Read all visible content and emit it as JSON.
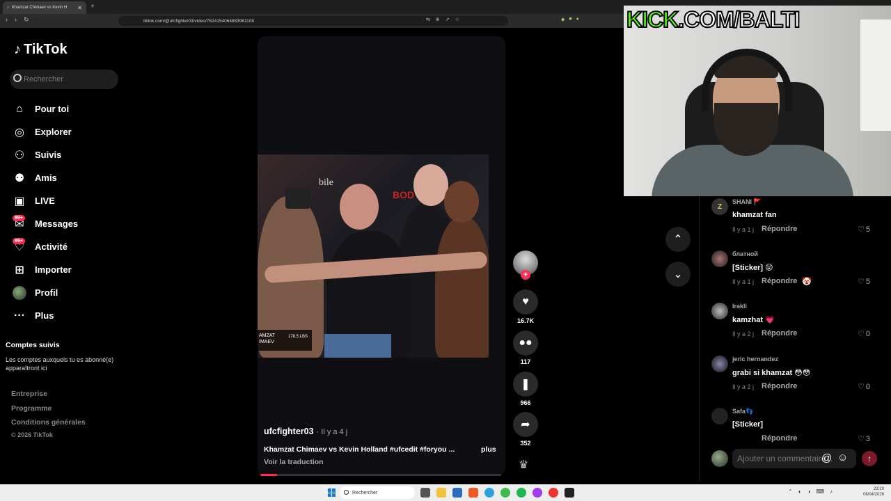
{
  "browser": {
    "tab_title": "Khamzat Chimaev vs Kevin H",
    "url": "tiktok.com/@ufcfighter03/video/7624154064883961108"
  },
  "sidebar": {
    "logo": "TikTok",
    "search_placeholder": "Rechercher",
    "items": [
      {
        "label": "Pour toi",
        "icon": "home-icon"
      },
      {
        "label": "Explorer",
        "icon": "compass-icon"
      },
      {
        "label": "Suivis",
        "icon": "following-icon"
      },
      {
        "label": "Amis",
        "icon": "friends-icon"
      },
      {
        "label": "LIVE",
        "icon": "live-icon"
      },
      {
        "label": "Messages",
        "icon": "messages-icon",
        "badge": "99+"
      },
      {
        "label": "Activité",
        "icon": "activity-icon",
        "badge": "99+"
      },
      {
        "label": "Importer",
        "icon": "upload-icon"
      },
      {
        "label": "Profil",
        "icon": "profile-avatar"
      },
      {
        "label": "Plus",
        "icon": "more-icon"
      }
    ],
    "followed_title": "Comptes suivis",
    "followed_desc": "Les comptes auxquels tu es abonné(e) apparaîtront ici",
    "footer_links": [
      "Entreprise",
      "Programme",
      "Conditions générales"
    ],
    "copyright": "© 2026 TikTok"
  },
  "video": {
    "overlay_text_1": "bile",
    "overlay_text_2": "BOD",
    "weigh_name": "AMZAT\nIMAEV",
    "weigh_lbs": "178.5 LBS",
    "author": "ufcfighter03",
    "posted": "· Il y a 4 j",
    "description": "Khamzat Chimaev vs Kevin Holland  #ufcedit #foryou ...",
    "more": "plus",
    "translate": "Voir la traduction",
    "progress": 0.07
  },
  "actions": {
    "likes": "16.7K",
    "comments": "117",
    "saves": "966",
    "shares": "352"
  },
  "stream_overlay": {
    "kick_part": "KICK",
    "rest": ".COM/BALTI"
  },
  "comments": [
    {
      "avatar": "Z",
      "user": "SHANI 🚩",
      "text": "khamzat fan",
      "time": "Il y a 1 j",
      "reply": "Répondre",
      "likes": "5"
    },
    {
      "avatar": "",
      "user": "блатной",
      "text": "[Sticker] 😝",
      "time": "Il y a 1 j",
      "reply": "Répondre",
      "likes": "5",
      "react": "🤡"
    },
    {
      "avatar": "",
      "user": "Irakli",
      "text": "kamzhat 💗",
      "time": "Il y a 2 j",
      "reply": "Répondre",
      "likes": "0"
    },
    {
      "avatar": "",
      "user": "jeric hernandez",
      "text": "grabi si khamzat 😳😳",
      "time": "Il y a 2 j",
      "reply": "Répondre",
      "likes": "0"
    },
    {
      "avatar": "",
      "user": "Safa👣",
      "text": "[Sticker]",
      "time": "",
      "reply": "Répondre",
      "likes": "3"
    }
  ],
  "comment_input": {
    "placeholder": "Ajouter un commentaire..."
  },
  "taskbar": {
    "search": "Rechercher",
    "time": "23:20",
    "date": "06/04/2026"
  }
}
